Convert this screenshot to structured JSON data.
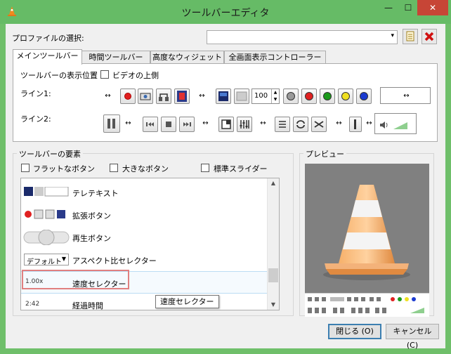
{
  "window": {
    "title": "ツールバーエディタ",
    "min_glyph": "—",
    "max_glyph": "☐",
    "close_glyph": "✕"
  },
  "profile": {
    "label": "プロファイルの選択:",
    "value": "",
    "arrow": "▾"
  },
  "tabs": [
    {
      "label": "メインツールバー",
      "active": true
    },
    {
      "label": "時間ツールバー",
      "active": false
    },
    {
      "label": "高度なウィジェット",
      "active": false
    },
    {
      "label": "全画面表示コントローラー",
      "active": false
    }
  ],
  "toolbar": {
    "position_label": "ツールバーの表示位置",
    "above_video_label": "ビデオの上側",
    "above_video_checked": false,
    "line1_label": "ライン1:",
    "line2_label": "ライン2:",
    "volume_value": "100",
    "spacer_glyph": "↔"
  },
  "elements": {
    "group_title": "ツールバーの要素",
    "flat_label": "フラットなボタン",
    "big_label": "大きなボタン",
    "slider_label": "標準スライダー",
    "items": [
      {
        "name": "テレテキスト"
      },
      {
        "name": "拡張ボタン"
      },
      {
        "name": "再生ボタン"
      },
      {
        "name": "アスペクト比セレクター",
        "combo": "デフォルト"
      },
      {
        "name": "速度セレクター",
        "value": "1.00x",
        "selected": true
      },
      {
        "name": "経過時間",
        "value": "2:42"
      }
    ],
    "tooltip": "速度セレクター"
  },
  "preview": {
    "title": "プレビュー"
  },
  "buttons": {
    "close": "閉じる (O)",
    "cancel": "キャンセル (C)"
  },
  "colors": {
    "titlebar": "#66bb66",
    "close_red": "#c74536",
    "dot_gray": "#9a9a9a",
    "dot_red": "#e02020",
    "dot_green": "#1a9a1a",
    "dot_yellow": "#f0e020",
    "dot_blue": "#1a3ad0",
    "highlight": "#e08080"
  }
}
